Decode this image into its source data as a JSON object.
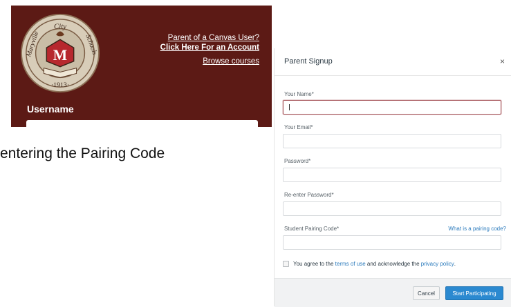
{
  "login": {
    "parent_link_line1": "Parent of a Canvas User?",
    "parent_link_line2": "Click Here For an Account",
    "browse_courses": "Browse courses",
    "username_label": "Username",
    "seal": {
      "top_text": "Maryville City Schools",
      "city_word": "City",
      "year": "1913",
      "letter": "M"
    },
    "brand_color": "#5c1a15"
  },
  "caption": "entering the Pairing Code",
  "modal": {
    "title": "Parent Signup",
    "close_icon": "×",
    "fields": [
      {
        "label": "Your Name*",
        "value": "",
        "active": true
      },
      {
        "label": "Your Email*",
        "value": ""
      },
      {
        "label": "Password*",
        "value": ""
      },
      {
        "label": "Re-enter Password*",
        "value": ""
      },
      {
        "label": "Student Pairing Code*",
        "value": ""
      }
    ],
    "pairing_help": "What is a pairing code?",
    "agree": {
      "prefix": "You agree to the",
      "terms": "terms of use",
      "middle": "and acknowledge the",
      "privacy": "privacy policy",
      "suffix": "."
    },
    "cancel": "Cancel",
    "start": "Start Participating",
    "accent_color": "#2b89d0"
  }
}
